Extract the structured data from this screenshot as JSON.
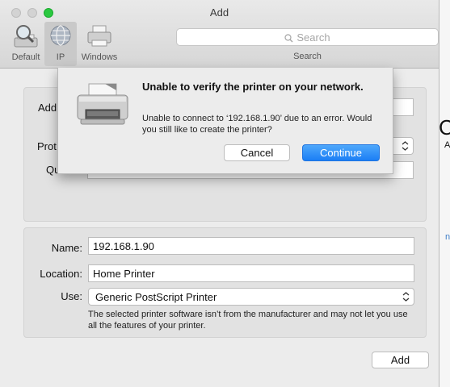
{
  "window": {
    "title": "Add"
  },
  "toolbar": {
    "tools": [
      {
        "label": "Default",
        "icon": "magnifier-printer-icon",
        "selected": false
      },
      {
        "label": "IP",
        "icon": "globe-icon",
        "selected": true
      },
      {
        "label": "Windows",
        "icon": "printer-icon",
        "selected": false
      }
    ],
    "search": {
      "placeholder": "Search",
      "label": "Search"
    }
  },
  "top_panel": {
    "labels": [
      "Add",
      "Prot",
      "Qu"
    ]
  },
  "bottom_panel": {
    "name_label": "Name:",
    "name_value": "192.168.1.90",
    "location_label": "Location:",
    "location_value": "Home Printer",
    "use_label": "Use:",
    "use_value": "Generic PostScript Printer",
    "note": "The selected printer software isn’t from the manufacturer and may not let you use all the features of your printer."
  },
  "add_button": "Add",
  "alert": {
    "heading": "Unable to verify the printer on your network.",
    "message": "Unable to connect to ‘192.168.1.90’ due to an error. Would you still like to create the printer?",
    "cancel": "Cancel",
    "continue": "Continue",
    "icon": "printer-icon"
  },
  "background": {
    "glyph1": "C",
    "glyph2": "A",
    "glyph3": "n"
  },
  "colors": {
    "accent": "#1b7ef5",
    "zoom": "#2bc840"
  }
}
